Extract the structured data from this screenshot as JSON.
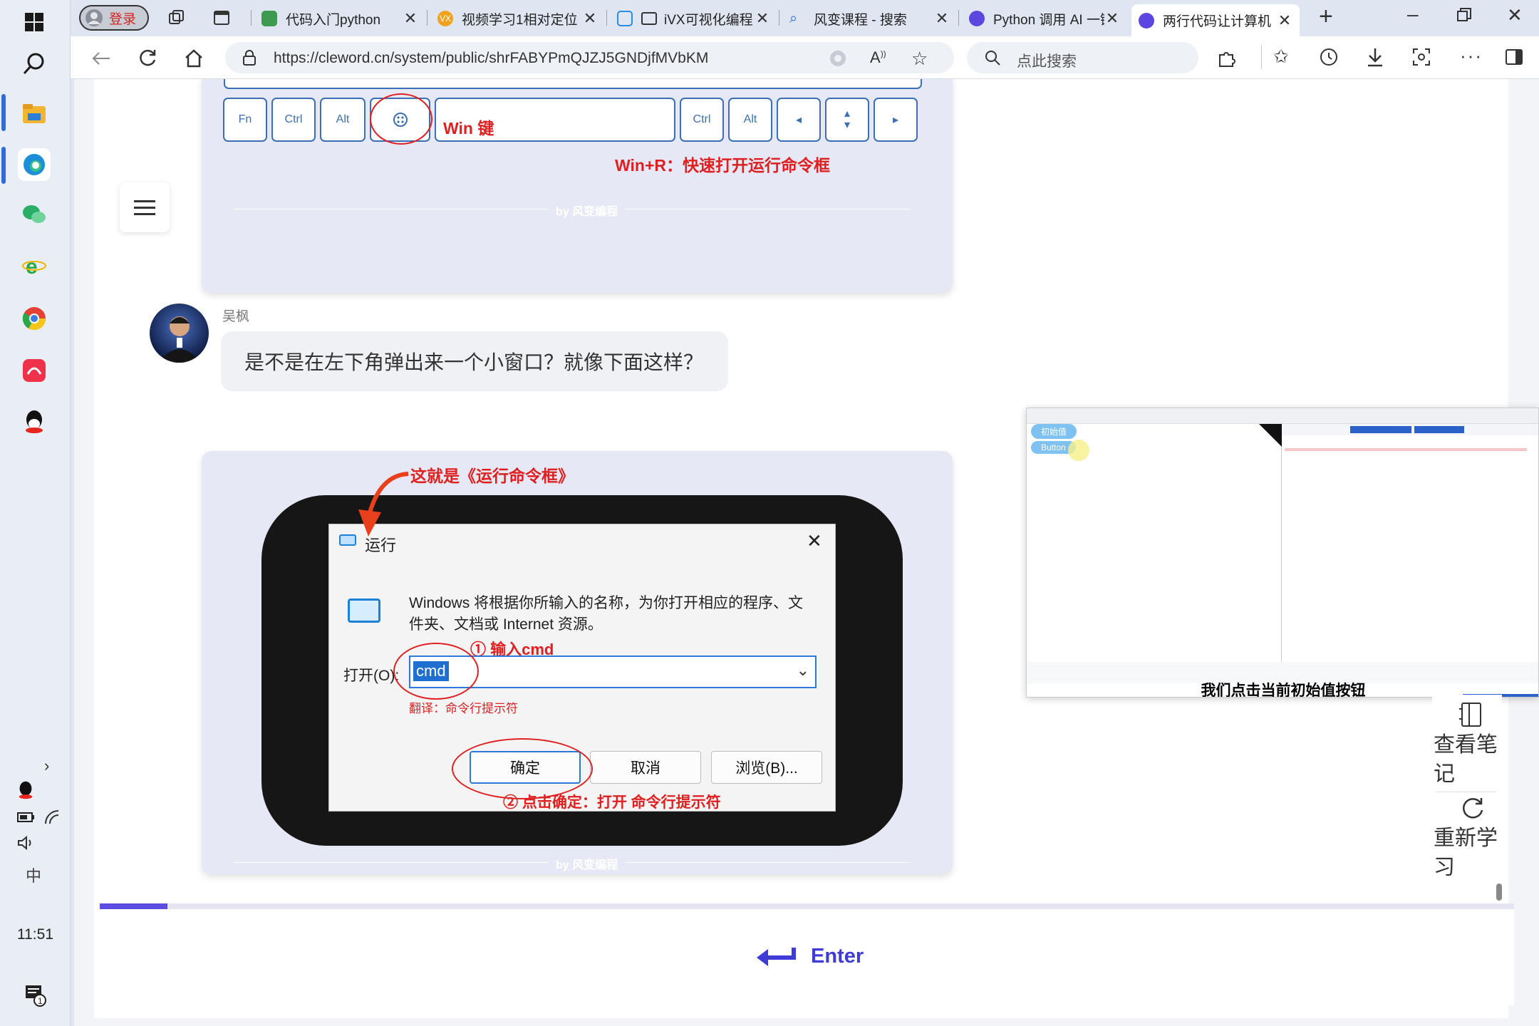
{
  "taskbar": {
    "clock": "11:51"
  },
  "tabs": [
    {
      "label": "登录",
      "icon": "profile-icon"
    },
    {
      "label": "代码入门python",
      "icon": "code-icon"
    },
    {
      "label": "视频学习1相对定位",
      "icon": "vx-icon"
    },
    {
      "label": "iVX可视化编程",
      "icon": "ivx-icon"
    },
    {
      "label": "风变课程 - 搜索",
      "icon": "search-icon"
    },
    {
      "label": "Python 调用 AI 一键",
      "icon": "ai-icon"
    },
    {
      "label": "两行代码让计算机",
      "icon": "ai-icon",
      "active": true
    }
  ],
  "address": {
    "url": "https://cleword.cn/system/public/shrFABYPmQJZJ5GNDjfMVbKM",
    "search_placeholder": "点此搜索"
  },
  "keyboard_card": {
    "keys": [
      "Fn",
      "Ctrl",
      "Alt",
      "Ctrl",
      "Alt",
      "◂",
      "▴\n▾",
      "▸"
    ],
    "win_label": "Win 键",
    "shortcut_note": "Win+R：快速打开运行命令框",
    "credit": "by 风变编程"
  },
  "message": {
    "sender": "吴枫",
    "text": "是不是在左下角弹出来一个小窗口？就像下面这样？"
  },
  "run_card": {
    "title_note": "这就是《运行命令框》",
    "dialog_title": "运行",
    "description": "Windows 将根据你所输入的名称，为你打开相应的程序、文件夹、文档或 Internet 资源。",
    "step1": "① 输入cmd",
    "open_label": "打开(O):",
    "input_value": "cmd",
    "translation": "翻译：命令行提示符",
    "ok_label": "确定",
    "cancel_label": "取消",
    "browse_label": "浏览(B)...",
    "step2": "② 点击确定：打开 命令行提示符",
    "credit": "by 风变编程"
  },
  "mini_video": {
    "btn1": "初始值",
    "btn2": "Button",
    "subtitle": "我们点击当前初始值按钮"
  },
  "side_panel": {
    "notes_label": "查看笔记",
    "relearn_label": "重新学习"
  },
  "progress": {
    "fraction": 0.048
  },
  "enter": {
    "label": "Enter"
  }
}
